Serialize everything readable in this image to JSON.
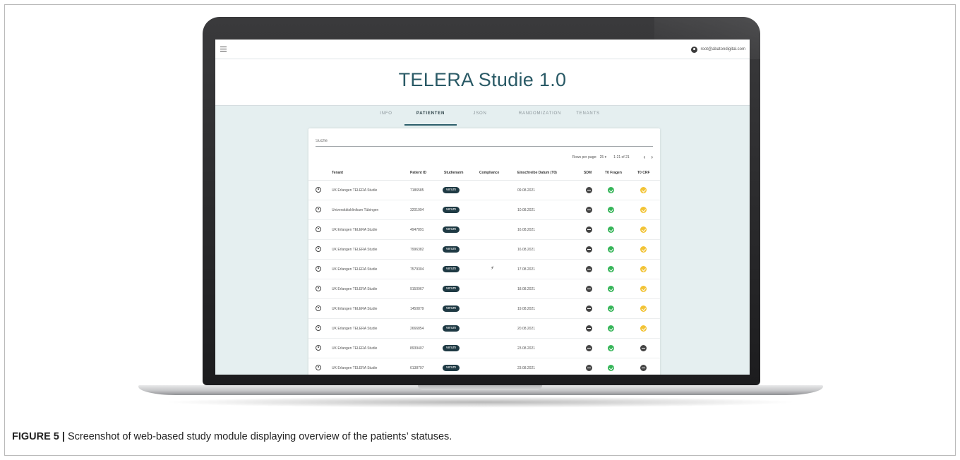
{
  "app": {
    "account_email": "root@abatondigital.com",
    "title": "TELERA Studie 1.0"
  },
  "tabs": [
    {
      "label": "INFO",
      "active": false
    },
    {
      "label": "PATIENTEN",
      "active": true
    },
    {
      "label": "JSON",
      "active": false
    },
    {
      "label": "RANDOMIZATION",
      "active": false
    },
    {
      "label": "TENANTS",
      "active": false
    }
  ],
  "search": {
    "placeholder": "Suche",
    "value": ""
  },
  "pager": {
    "rows_per_page_label": "Rows per page:",
    "rows_per_page_value": "25 ▾",
    "range": "1-21 of 21",
    "prev": "‹",
    "next": "›"
  },
  "table": {
    "columns": [
      "Tenant",
      "Patient ID",
      "Studienarm",
      "Compliance",
      "Einschreibe Datum (T0)",
      "SDM",
      "T0 Fragen",
      "T0 CRF"
    ],
    "rows": [
      {
        "tenant": "UK Erlangen TELERA Studie",
        "patient_id": "7186585",
        "arm": "verum",
        "compliance": "",
        "date": "09.08.2021",
        "sdm": "minus",
        "t0_fragen": "check",
        "t0_crf": "pending"
      },
      {
        "tenant": "Universitätsklinikum Tübingen",
        "patient_id": "3201994",
        "arm": "verum",
        "compliance": "",
        "date": "10.08.2021",
        "sdm": "minus",
        "t0_fragen": "check",
        "t0_crf": "pending"
      },
      {
        "tenant": "UK Erlangen TELERA Studie",
        "patient_id": "4947891",
        "arm": "verum",
        "compliance": "",
        "date": "16.08.2021",
        "sdm": "minus",
        "t0_fragen": "check",
        "t0_crf": "pending"
      },
      {
        "tenant": "UK Erlangen TELERA Studie",
        "patient_id": "7996382",
        "arm": "verum",
        "compliance": "",
        "date": "16.08.2021",
        "sdm": "minus",
        "t0_fragen": "check",
        "t0_crf": "pending"
      },
      {
        "tenant": "UK Erlangen TELERA Studie",
        "patient_id": "7579304",
        "arm": "verum",
        "compliance": "⚡",
        "date": "17.08.2021",
        "sdm": "minus",
        "t0_fragen": "check",
        "t0_crf": "pending"
      },
      {
        "tenant": "UK Erlangen TELERA Studie",
        "patient_id": "9150967",
        "arm": "verum",
        "compliance": "",
        "date": "18.08.2021",
        "sdm": "minus",
        "t0_fragen": "check",
        "t0_crf": "pending"
      },
      {
        "tenant": "UK Erlangen TELERA Studie",
        "patient_id": "1450879",
        "arm": "verum",
        "compliance": "",
        "date": "19.08.2021",
        "sdm": "minus",
        "t0_fragen": "check",
        "t0_crf": "pending"
      },
      {
        "tenant": "UK Erlangen TELERA Studie",
        "patient_id": "2666854",
        "arm": "verum",
        "compliance": "",
        "date": "20.08.2021",
        "sdm": "minus",
        "t0_fragen": "check",
        "t0_crf": "pending"
      },
      {
        "tenant": "UK Erlangen TELERA Studie",
        "patient_id": "8939407",
        "arm": "verum",
        "compliance": "",
        "date": "23.08.2021",
        "sdm": "minus",
        "t0_fragen": "check",
        "t0_crf": "minus"
      },
      {
        "tenant": "UK Erlangen TELERA Studie",
        "patient_id": "6138797",
        "arm": "verum",
        "compliance": "",
        "date": "23.08.2021",
        "sdm": "minus",
        "t0_fragen": "check",
        "t0_crf": "minus"
      }
    ]
  },
  "colors": {
    "accent": "#2a5a66",
    "screen_bg": "#e5eff0",
    "badge": "#1f3a44",
    "check": "#35b558",
    "pending": "#f2c335",
    "minus": "#444444"
  },
  "caption": {
    "label": "FIGURE 5 |",
    "text": " Screenshot of web-based study module displaying overview of the patients’ statuses."
  }
}
